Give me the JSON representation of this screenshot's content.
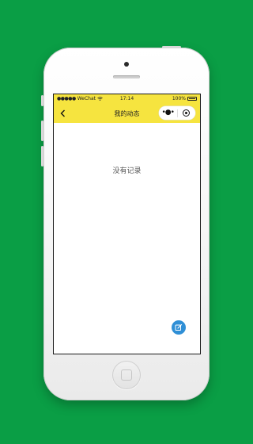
{
  "background_color": "#0a9e45",
  "nav_color": "#f6e43f",
  "status_bar": {
    "signal": "●●●●●",
    "carrier": "WeChat",
    "time": "17:14",
    "battery": "100%"
  },
  "nav_bar": {
    "title": "我的动态",
    "more_icon": "ellipsis-icon",
    "close_icon": "target-circle-icon"
  },
  "main": {
    "empty_text": "没有记录"
  },
  "fab": {
    "icon": "edit-icon",
    "color": "#2f8fd6"
  }
}
